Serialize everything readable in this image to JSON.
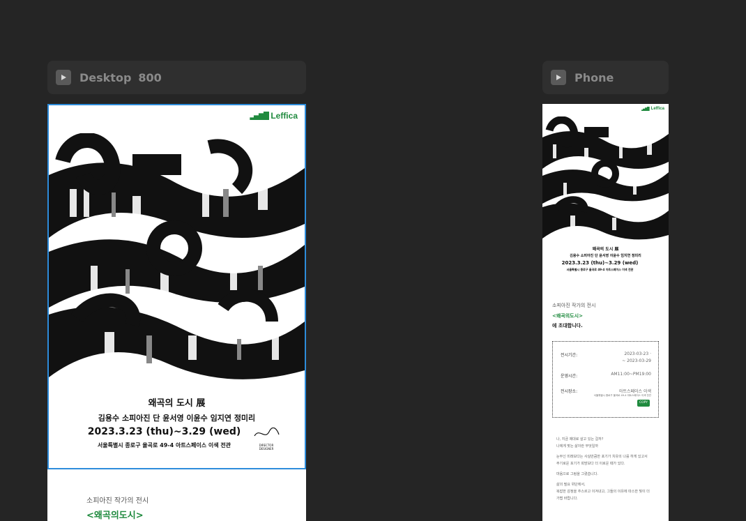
{
  "frames": {
    "desktop": {
      "name": "Desktop",
      "size": "800"
    },
    "phone": {
      "name": "Phone"
    }
  },
  "poster": {
    "brand": "Leffica",
    "exhibition_title": "왜곡의 도시 展",
    "artists": "김용수  소피아진  단  윤서영  이윤수  임지연  정미리",
    "dates": "2023.3.23 (thu)~3.29 (wed)",
    "venue": "서울특별시 종로구 율곡로 49-4  아트스페이스 이색 전관",
    "signature_caption": "DIRECTOR\nDESIGNER"
  },
  "intro": {
    "small": "소피아진 작가의 전시",
    "highlight": "<왜곡의도시>",
    "invite": "에 초대합니다."
  },
  "info": {
    "period_label": "전시기간:",
    "period_value_1": "2023-03-23  ·",
    "period_value_2": "~  2023-03-29",
    "hours_label": "운영시간:",
    "hours_value": "AM11:00~PM19:00",
    "place_label": "전시장소:",
    "place_value": "아트스페이스 이색",
    "place_address": "서울특별시 종로구 율곡로 49-4 아트스페이스 이색 전관",
    "copy_label": "COPY"
  },
  "notes": [
    "나, 지금 제대로 살고 있는 걸까?",
    "나에게 맞는 삶이란 무엇일까",
    "",
    "눈부신 미래보다는 사실만큼한 포기가 치유의 나를 하게 있고서",
    "주기로운 포기가 희망보다 더 이로운 때가 있다.",
    "",
    "마음으로 그림을 그렸습니다.",
    "",
    "삶의 필요 위단에서,",
    "복잡한 감정을 추스르고 이겨내고, 그들의 이유에 따스한 빛이 더",
    "가볍 바랍니다."
  ],
  "colors": {
    "accent": "#1f8a3e",
    "selection": "#2d8cdb",
    "canvas": "#252525"
  }
}
